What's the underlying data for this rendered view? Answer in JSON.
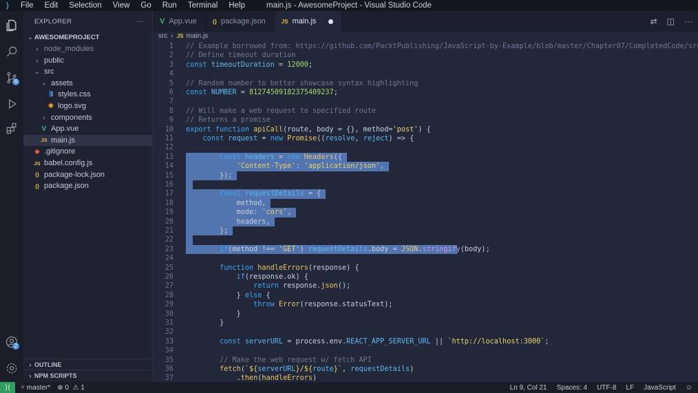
{
  "window": {
    "title": "main.js - AwesomeProject - Visual Studio Code"
  },
  "menu": [
    "File",
    "Edit",
    "Selection",
    "View",
    "Go",
    "Run",
    "Terminal",
    "Help"
  ],
  "activity": {
    "scm_badge": "6",
    "accounts_badge": "2"
  },
  "explorer": {
    "title": "EXPLORER",
    "more": "···",
    "project": "AWESOMEPROJECT",
    "items": [
      {
        "label": "node_modules",
        "type": "folder",
        "open": false,
        "depth": 1,
        "muted": true
      },
      {
        "label": "public",
        "type": "folder",
        "open": false,
        "depth": 1
      },
      {
        "label": "src",
        "type": "folder",
        "open": true,
        "depth": 1
      },
      {
        "label": "assets",
        "type": "folder",
        "open": true,
        "depth": 2
      },
      {
        "label": "styles.css",
        "type": "css",
        "depth": 3
      },
      {
        "label": "logo.svg",
        "type": "svg",
        "depth": 3
      },
      {
        "label": "components",
        "type": "folder",
        "open": false,
        "depth": 2
      },
      {
        "label": "App.vue",
        "type": "vue",
        "depth": 2
      },
      {
        "label": "main.js",
        "type": "js",
        "depth": 2,
        "selected": true
      },
      {
        "label": ".gitignore",
        "type": "git",
        "depth": 1
      },
      {
        "label": "babel.config.js",
        "type": "js",
        "depth": 1
      },
      {
        "label": "package-lock.json",
        "type": "json",
        "depth": 1
      },
      {
        "label": "package.json",
        "type": "json",
        "depth": 1
      }
    ],
    "outline": "OUTLINE",
    "npm_scripts": "NPM SCRIPTS"
  },
  "tabs": [
    {
      "label": "App.vue",
      "icon": "V",
      "color": "#41b883",
      "active": false
    },
    {
      "label": "package.json",
      "icon": "{}",
      "color": "#e2c04a",
      "active": false
    },
    {
      "label": "main.js",
      "icon": "JS",
      "color": "#e2c04a",
      "active": true,
      "dirty": true
    }
  ],
  "breadcrumb": {
    "folder": "src",
    "file": "main.js"
  },
  "colors": {
    "comment": "#6f7791",
    "keyword": "#3fa7f0",
    "ident": "#5fb8f0",
    "string": "#e6d36b",
    "number": "#a6d96a",
    "func": "#e6c66a",
    "plain": "#c9ced9",
    "purple": "#c792ea"
  },
  "code_lines": [
    [
      [
        "comment",
        "// Example borrowed from: https://github.com/PacktPublishing/JavaScript-by-Example/blob/master/Chapter07/CompletedCode/src/s"
      ]
    ],
    [
      [
        "comment",
        "// Define timeout duration"
      ]
    ],
    [
      [
        "keyword",
        "const "
      ],
      [
        "ident",
        "timeoutDuration"
      ],
      [
        "plain",
        " = "
      ],
      [
        "number",
        "12000"
      ],
      [
        "plain",
        ";"
      ]
    ],
    [],
    [
      [
        "comment",
        "// Random number to better showcase syntax highlighting"
      ]
    ],
    [
      [
        "keyword",
        "const "
      ],
      [
        "ident",
        "NUMBER"
      ],
      [
        "plain",
        " = "
      ],
      [
        "number",
        "81274509182375409237"
      ],
      [
        "plain",
        ";"
      ]
    ],
    [],
    [
      [
        "comment",
        "// Will make a web request to specified route"
      ]
    ],
    [
      [
        "comment",
        "// Returns a promise"
      ]
    ],
    [
      [
        "keyword",
        "export function "
      ],
      [
        "func",
        "apiCall"
      ],
      [
        "plain",
        "(route, body = {}, method="
      ],
      [
        "string",
        "'post'"
      ],
      [
        "plain",
        ") {"
      ]
    ],
    [
      [
        "plain",
        "    "
      ],
      [
        "keyword",
        "const "
      ],
      [
        "ident",
        "request"
      ],
      [
        "plain",
        " = "
      ],
      [
        "keyword",
        "new "
      ],
      [
        "func",
        "Promise"
      ],
      [
        "plain",
        "(("
      ],
      [
        "ident",
        "resolve"
      ],
      [
        "plain",
        ", "
      ],
      [
        "ident",
        "reject"
      ],
      [
        "plain",
        ") => {"
      ]
    ],
    [],
    [
      [
        "plain",
        "        "
      ],
      [
        "keyword",
        "const "
      ],
      [
        "ident",
        "headers"
      ],
      [
        "plain",
        " = "
      ],
      [
        "keyword",
        "new "
      ],
      [
        "func",
        "Headers"
      ],
      [
        "plain",
        "({"
      ]
    ],
    [
      [
        "plain",
        "            "
      ],
      [
        "string",
        "'Content-Type'"
      ],
      [
        "plain",
        ": "
      ],
      [
        "string",
        "'application/json'"
      ],
      [
        "plain",
        ","
      ]
    ],
    [
      [
        "plain",
        "        });"
      ]
    ],
    [],
    [
      [
        "plain",
        "        "
      ],
      [
        "keyword",
        "const "
      ],
      [
        "ident",
        "requestDetails"
      ],
      [
        "plain",
        " = {"
      ]
    ],
    [
      [
        "plain",
        "            method,"
      ]
    ],
    [
      [
        "plain",
        "            mode: "
      ],
      [
        "string",
        "'cors'"
      ],
      [
        "plain",
        ","
      ]
    ],
    [
      [
        "plain",
        "            headers,"
      ]
    ],
    [
      [
        "plain",
        "        };"
      ]
    ],
    [],
    [
      [
        "plain",
        "        "
      ],
      [
        "keyword",
        "if"
      ],
      [
        "plain",
        "(method !== "
      ],
      [
        "string",
        "'GET'"
      ],
      [
        "plain",
        ") "
      ],
      [
        "ident",
        "requestDetails"
      ],
      [
        "plain",
        ".body = "
      ],
      [
        "func",
        "JSON"
      ],
      [
        "plain",
        "."
      ],
      [
        "purple",
        "stringify"
      ],
      [
        "plain",
        "(body);"
      ]
    ],
    [],
    [
      [
        "plain",
        "        "
      ],
      [
        "keyword",
        "function "
      ],
      [
        "func",
        "handleErrors"
      ],
      [
        "plain",
        "(response) {"
      ]
    ],
    [
      [
        "plain",
        "            "
      ],
      [
        "keyword",
        "if"
      ],
      [
        "plain",
        "(response.ok) {"
      ]
    ],
    [
      [
        "plain",
        "                "
      ],
      [
        "keyword",
        "return "
      ],
      [
        "plain",
        "response."
      ],
      [
        "func",
        "json"
      ],
      [
        "plain",
        "();"
      ]
    ],
    [
      [
        "plain",
        "            } "
      ],
      [
        "keyword",
        "else "
      ],
      [
        "plain",
        "{"
      ]
    ],
    [
      [
        "plain",
        "                "
      ],
      [
        "keyword",
        "throw "
      ],
      [
        "func",
        "Error"
      ],
      [
        "plain",
        "(response.statusText);"
      ]
    ],
    [
      [
        "plain",
        "            }"
      ]
    ],
    [
      [
        "plain",
        "        }"
      ]
    ],
    [],
    [
      [
        "plain",
        "        "
      ],
      [
        "keyword",
        "const "
      ],
      [
        "ident",
        "serverURL"
      ],
      [
        "plain",
        " = process.env."
      ],
      [
        "ident",
        "REACT_APP_SERVER_URL"
      ],
      [
        "plain",
        " || "
      ],
      [
        "string",
        "`http://localhost:3000`"
      ],
      [
        "plain",
        ";"
      ]
    ],
    [],
    [
      [
        "plain",
        "        "
      ],
      [
        "comment",
        "// Make the web request w/ fetch API"
      ]
    ],
    [
      [
        "plain",
        "        "
      ],
      [
        "func",
        "fetch"
      ],
      [
        "plain",
        "("
      ],
      [
        "string",
        "`${"
      ],
      [
        "ident",
        "serverURL"
      ],
      [
        "string",
        "}/${"
      ],
      [
        "ident",
        "route"
      ],
      [
        "string",
        "}`"
      ],
      [
        "plain",
        ", "
      ],
      [
        "ident",
        "requestDetails"
      ],
      [
        "plain",
        ")"
      ]
    ],
    [
      [
        "plain",
        "            ."
      ],
      [
        "func",
        "then"
      ],
      [
        "plain",
        "("
      ],
      [
        "func",
        "handleErrors"
      ],
      [
        "plain",
        ")"
      ]
    ]
  ],
  "status": {
    "branch": "master*",
    "errors": "0",
    "warnings": "1",
    "position": "Ln 9, Col 21",
    "spaces": "Spaces: 4",
    "encoding": "UTF-8",
    "eol": "LF",
    "language": "JavaScript"
  }
}
